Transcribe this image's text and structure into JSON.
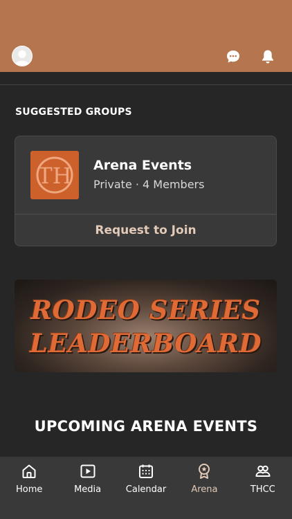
{
  "header": {
    "avatar": "user-avatar",
    "icons": [
      "chat-icon",
      "bell-icon"
    ],
    "color": "#b5764f"
  },
  "suggested": {
    "title": "SUGGESTED GROUPS",
    "group": {
      "logo_letters": "TH",
      "name": "Arena Events",
      "meta": "Private · 4 Members",
      "action": "Request to Join"
    }
  },
  "banner": {
    "line1": "RODEO SERIES",
    "line2": "LEADERBOARD"
  },
  "events": {
    "title": "UPCOMING ARENA EVENTS"
  },
  "nav": {
    "items": [
      {
        "label": "Home",
        "icon": "home-icon"
      },
      {
        "label": "Media",
        "icon": "media-icon"
      },
      {
        "label": "Calendar",
        "icon": "calendar-icon"
      },
      {
        "label": "Arena",
        "icon": "award-icon",
        "active": true
      },
      {
        "label": "THCC",
        "icon": "people-icon"
      }
    ],
    "active_color": "#e3cab8"
  }
}
